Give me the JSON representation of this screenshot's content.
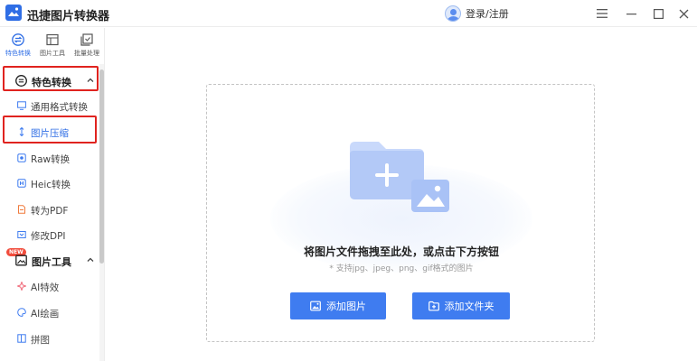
{
  "app": {
    "title": "迅捷图片转换器"
  },
  "header": {
    "login_label": "登录/注册"
  },
  "top_tabs": [
    {
      "label": "特色转换",
      "icon": "convert-icon",
      "active": true
    },
    {
      "label": "图片工具",
      "icon": "image-tool-icon",
      "active": false
    },
    {
      "label": "批量处理",
      "icon": "batch-icon",
      "active": false
    }
  ],
  "sidebar": {
    "section_featured": {
      "label": "特色转换",
      "icon": "swap-icon"
    },
    "items_featured": [
      {
        "label": "通用格式转换",
        "icon": "monitor-icon"
      },
      {
        "label": "图片压缩",
        "icon": "compress-icon",
        "selected": true
      },
      {
        "label": "Raw转换",
        "icon": "raw-icon"
      },
      {
        "label": "Heic转换",
        "icon": "heic-icon"
      },
      {
        "label": "转为PDF",
        "icon": "pdf-icon"
      },
      {
        "label": "修改DPI",
        "icon": "dpi-icon",
        "badge": "NEW"
      }
    ],
    "section_tools": {
      "label": "图片工具",
      "icon": "image-icon"
    },
    "items_tools": [
      {
        "label": "AI特效",
        "icon": "ai-effect-icon"
      },
      {
        "label": "AI绘画",
        "icon": "ai-paint-icon"
      },
      {
        "label": "拼图",
        "icon": "collage-icon"
      }
    ]
  },
  "dropzone": {
    "title": "将图片文件拖拽至此处，或点击下方按钮",
    "hint": "* 支持jpg、jpeg、png、gif格式的图片",
    "add_image_label": "添加图片",
    "add_folder_label": "添加文件夹"
  },
  "colors": {
    "accent": "#3f7cf0",
    "highlight": "#e0231f",
    "badge": "#f14c3c"
  }
}
